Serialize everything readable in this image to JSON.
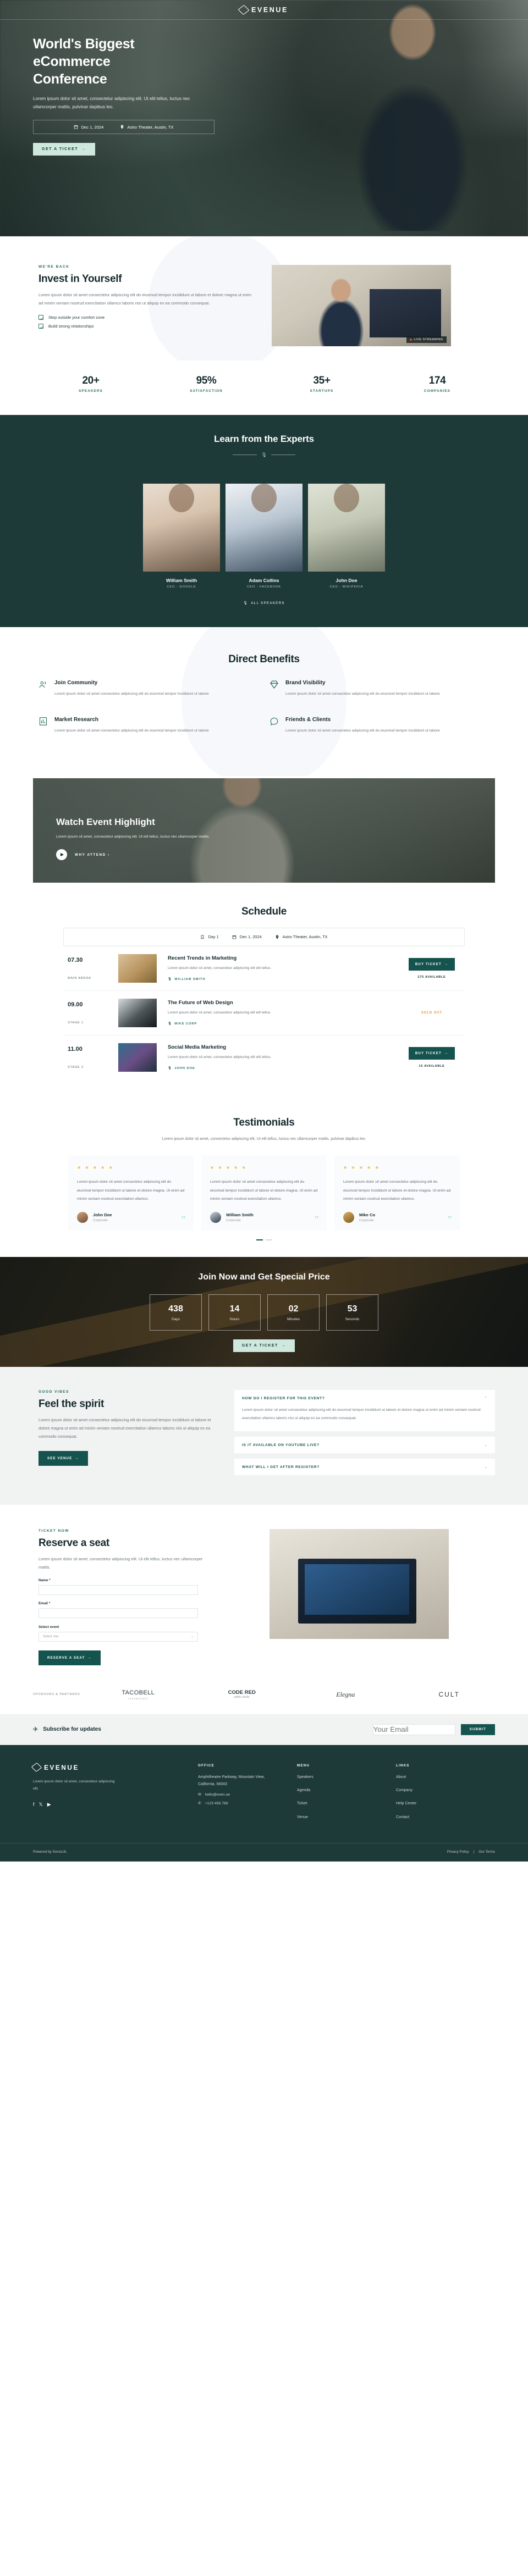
{
  "brand": {
    "name": "EVENUE",
    "mark_icon": "ticket-icon"
  },
  "hero": {
    "title_line1": "World's Biggest",
    "title_line2": "eCommerce",
    "title_line3": "Conference",
    "subtitle": "Lorem ipsum dolor sit amet, consectetur adipiscing elit. Ut elit tellus, luctus nec ullamcorper mattis, pulvinar dapibus leo.",
    "date": "Dec 1, 2024",
    "date_icon": "calendar-icon",
    "location": "Astro Theater, Austin, TX",
    "location_icon": "map-pin-icon",
    "cta": "GET A TICKET"
  },
  "invest": {
    "eyebrow": "WE'RE BACK",
    "title": "Invest in Yourself",
    "paragraph": "Lorem ipsum dolor sit amet consectetur adipiscing elit do eiusmod tempor incididunt ut labore et dolore magna ut enim ad minim veniam nostrud exercitation ullamco laboris nisi ut aliquip ex ea commodo consequat.",
    "checks": [
      "Step outside your comfort zone",
      "Build strong relationships"
    ],
    "live_badge": "LIVE STREAMING"
  },
  "stats": [
    {
      "number": "20+",
      "label": "SPEAKERS"
    },
    {
      "number": "95%",
      "label": "SATISFACTION"
    },
    {
      "number": "35+",
      "label": "STARTUPS"
    },
    {
      "number": "174",
      "label": "COMPANIES"
    }
  ],
  "speakers": {
    "title": "Learn from the Experts",
    "divider_icon": "microphone-icon",
    "people": [
      {
        "name": "William Smith",
        "role": "CEO - GOOGLE"
      },
      {
        "name": "Adam Collins",
        "role": "CEO - FACEBOOK"
      },
      {
        "name": "John Doe",
        "role": "CEO - WIKIPEDIA"
      }
    ],
    "all_label": "ALL SPEAKERS"
  },
  "benefits": {
    "title": "Direct Benefits",
    "items": [
      {
        "icon": "users-icon",
        "title": "Join Community",
        "text": "Lorem ipsum dolor sit amet consectetur adipiscing elit do eiusmod tempor incididunt ut labore"
      },
      {
        "icon": "diamond-icon",
        "title": "Brand Visibility",
        "text": "Lorem ipsum dolor sit amet consectetur adipiscing elit do eiusmod tempor incididunt ut labore"
      },
      {
        "icon": "chart-icon",
        "title": "Market Research",
        "text": "Lorem ipsum dolor sit amet consectetur adipiscing elit do eiusmod tempor incididunt ut labore"
      },
      {
        "icon": "chat-bubble-icon",
        "title": "Friends & Clients",
        "text": "Lorem ipsum dolor sit amet consectetur adipiscing elit do eiusmod tempor incididunt ut labore"
      }
    ]
  },
  "video": {
    "title": "Watch Event Highlight",
    "text": "Lorem ipsum sit amet, consectetur adipiscing elit. Ut elit tellus, luctus nec ullamcorper mattis.",
    "play_icon": "play-icon",
    "link": "WHY ATTEND"
  },
  "schedule": {
    "title": "Schedule",
    "filters": {
      "day": "Day 1",
      "day_icon": "bookmark-icon",
      "date": "Dec 1, 2024",
      "date_icon": "calendar-icon",
      "venue": "Astro Theater, Austin, TX",
      "venue_icon": "map-pin-icon"
    },
    "rows": [
      {
        "time": "07.30",
        "place": "MAIN ARENA",
        "title": "Recent Trends in Marketing",
        "desc": "Lorem ipsum dolor sit amet, consectetur adipiscing elit elit tellus.",
        "speaker": "WILLIAM SMITH",
        "speaker_icon": "microphone-icon",
        "action": "BUY TICKET",
        "availability": "275 AVAILABLE",
        "sold_out": false
      },
      {
        "time": "09.00",
        "place": "STAGE 1",
        "title": "The Future of Web Design",
        "desc": "Lorem ipsum dolor sit amet, consectetur adipiscing elit elit tellus.",
        "speaker": "MIKE CORP",
        "speaker_icon": "microphone-icon",
        "action": "",
        "availability": "SOLD OUT",
        "sold_out": true
      },
      {
        "time": "11.00",
        "place": "STAGE 2",
        "title": "Social Media Marketing",
        "desc": "Lorem ipsum dolor sit amet, consectetur adipiscing elit elit tellus.",
        "speaker": "JOHN DOE",
        "speaker_icon": "microphone-icon",
        "action": "BUY TICKET",
        "availability": "15 AVAILABLE",
        "sold_out": false
      }
    ]
  },
  "testimonials": {
    "title": "Testimonials",
    "subtitle": "Lorem ipsum dolor sit amet, consectetur adipiscing elit. Ut elit tellus, luctus nec ullamcorper mattis, pulvinar dapibus leo.",
    "stars": "★ ★ ★ ★ ★",
    "items": [
      {
        "text": "Lorem ipsum dolor sit amet consectetur adipiscing elit do eiusmod tempor incididunt ut labore et dolore magna. Ut enim ad minim veniam nostrud exercitation ullamco.",
        "name": "John Doe",
        "role": "Corporate"
      },
      {
        "text": "Lorem ipsum dolor sit amet consectetur adipiscing elit do eiusmod tempor incididunt ut labore et dolore magna. Ut enim ad minim veniam nostrud exercitation ullamco.",
        "name": "William Smith",
        "role": "Corporate"
      },
      {
        "text": "Lorem ipsum dolor sit amet consectetur adipiscing elit do eiusmod tempor incididunt ut labore et dolore magna. Ut enim ad minim veniam nostrud exercitation ullamco.",
        "name": "Mike Co",
        "role": "Corporate"
      }
    ]
  },
  "countdown": {
    "title": "Join Now and Get Special Price",
    "units": [
      {
        "value": "438",
        "label": "Days"
      },
      {
        "value": "14",
        "label": "Hours"
      },
      {
        "value": "02",
        "label": "Minutes"
      },
      {
        "value": "53",
        "label": "Seconds"
      }
    ],
    "cta": "GET A TICKET"
  },
  "faq": {
    "eyebrow": "GOOD VIBES",
    "title": "Feel the spirit",
    "paragraph": "Lorem ipsum dolor sit amet consectetur adipiscing elit do eiusmod tempor incididunt ut labore et dolore magna ut enim ad minim veniam nostrud exercitation ullamco laboris nisi ut aliquip ex ea commodo consequat.",
    "cta": "SEE VENUE",
    "items": [
      {
        "question": "HOW DO I REGISTER FOR THIS EVENT?",
        "open": true,
        "answer": "Lorem ipsum dolor sit amet consectetur adipiscing elit do eiusmod tempor incididunt ut labore et dolore magna ut enim ad minim veniam nostrud exercitation ullamco laboris nisi ut aliquip ex ea commodo consequat."
      },
      {
        "question": "IS IT AVAILABLE ON YOUTUBE LIVE?",
        "open": false,
        "answer": ""
      },
      {
        "question": "WHAT WILL I GET AFTER REGISTER?",
        "open": false,
        "answer": ""
      }
    ]
  },
  "reserve": {
    "eyebrow": "TICKET NOW",
    "title": "Reserve a seat",
    "paragraph": "Lorem ipsum dolor sit amet, consectetur adipiscing elit. Ut elit tellus, luctus nec ullamcorper mattis.",
    "name_label": "Name *",
    "name_value": "",
    "email_label": "Email *",
    "email_value": "",
    "select_label": "Select event",
    "select_placeholder": "Select one",
    "cta": "RESERVE A SEAT"
  },
  "sponsors": {
    "label": "SPONSORS & PARTNERS",
    "items": [
      {
        "name": "TACOBELL",
        "sub": "restaurant"
      },
      {
        "name": "CODE RED",
        "sub": "public studio"
      },
      {
        "name": "Elegna",
        "sub": ""
      },
      {
        "name": "CULT",
        "sub": ""
      }
    ]
  },
  "subscribe": {
    "icon": "paper-plane-icon",
    "title": "Subscribe for updates",
    "placeholder": "Your Email",
    "value": "",
    "button": "SUBMIT"
  },
  "footer": {
    "brand": "EVENUE",
    "tagline": "Lorem ipsum dolor sit amet, consectetur adipiscing elit.",
    "social": [
      {
        "icon": "facebook-icon",
        "glyph": "f"
      },
      {
        "icon": "twitter-icon",
        "glyph": "t"
      },
      {
        "icon": "youtube-icon",
        "glyph": "▶"
      }
    ],
    "office": {
      "heading": "OFFICE",
      "address": "Amphitheatre Parkway, Mountain View, California, 94043",
      "email": "hello@even.ue",
      "email_icon": "envelope-icon",
      "phone": "+123 456 789",
      "phone_icon": "phone-icon"
    },
    "menu": {
      "heading": "MENU",
      "items": [
        "Speakers",
        "Agenda",
        "Ticket",
        "Venue"
      ]
    },
    "links": {
      "heading": "LINKS",
      "items": [
        "About",
        "Company",
        "Help Center",
        "Contact"
      ]
    },
    "powered": "Powered by SocioLib.",
    "legal": [
      "Privacy Policy",
      "Our Terms"
    ]
  },
  "colors": {
    "dark_teal": "#1d3a38",
    "teal": "#15544e",
    "mint": "#cfe8dd",
    "accent": "#2e6f63",
    "orange": "#e8963c",
    "star": "#f5b731"
  }
}
